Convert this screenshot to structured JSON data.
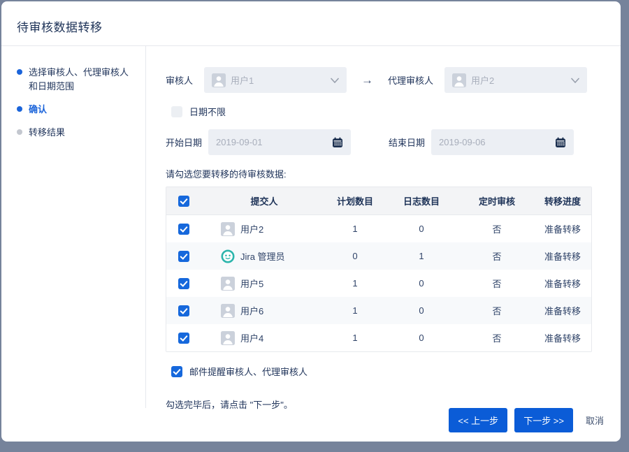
{
  "colors": {
    "accent": "#1668DC",
    "button-blue": "#0B5CD7",
    "frame": "#76839B",
    "step-active": "#1B64DA",
    "step-pending": "#C3C7CF",
    "teal": "#2CB5AC"
  },
  "dialog": {
    "title": "待审核数据转移"
  },
  "sidebar": {
    "steps": [
      {
        "label": "选择审核人、代理审核人和日期范围",
        "state": "done"
      },
      {
        "label": "确认",
        "state": "current"
      },
      {
        "label": "转移结果",
        "state": "pending"
      }
    ]
  },
  "form": {
    "reviewer_label": "审核人",
    "reviewer_value": "用户1",
    "arrow": "→",
    "proxy_reviewer_label": "代理审核人",
    "proxy_reviewer_value": "用户2",
    "no_date_limit_label": "日期不限",
    "no_date_limit_checked": false,
    "start_date_label": "开始日期",
    "start_date_value": "2019-09-01",
    "end_date_label": "结束日期",
    "end_date_value": "2019-09-06"
  },
  "table": {
    "caption": "请勾选您要转移的待审核数据:",
    "headers": [
      "提交人",
      "计划数目",
      "日志数目",
      "定时审核",
      "转移进度"
    ],
    "rows": [
      {
        "checked": true,
        "avatar": "person",
        "name": "用户2",
        "plan": "1",
        "log": "0",
        "timed": "否",
        "progress": "准备转移"
      },
      {
        "checked": true,
        "avatar": "jira-admin",
        "name": "Jira 管理员",
        "plan": "0",
        "log": "1",
        "timed": "否",
        "progress": "准备转移"
      },
      {
        "checked": true,
        "avatar": "person",
        "name": "用户5",
        "plan": "1",
        "log": "0",
        "timed": "否",
        "progress": "准备转移"
      },
      {
        "checked": true,
        "avatar": "person",
        "name": "用户6",
        "plan": "1",
        "log": "0",
        "timed": "否",
        "progress": "准备转移"
      },
      {
        "checked": true,
        "avatar": "person",
        "name": "用户4",
        "plan": "1",
        "log": "0",
        "timed": "否",
        "progress": "准备转移"
      }
    ]
  },
  "footer": {
    "email_notify_label": "邮件提醒审核人、代理审核人",
    "email_notify_checked": true,
    "hint": "勾选完毕后，请点击 \"下一步\"。",
    "prev_label": "<< 上一步",
    "next_label": "下一步 >>",
    "cancel_label": "取消"
  }
}
